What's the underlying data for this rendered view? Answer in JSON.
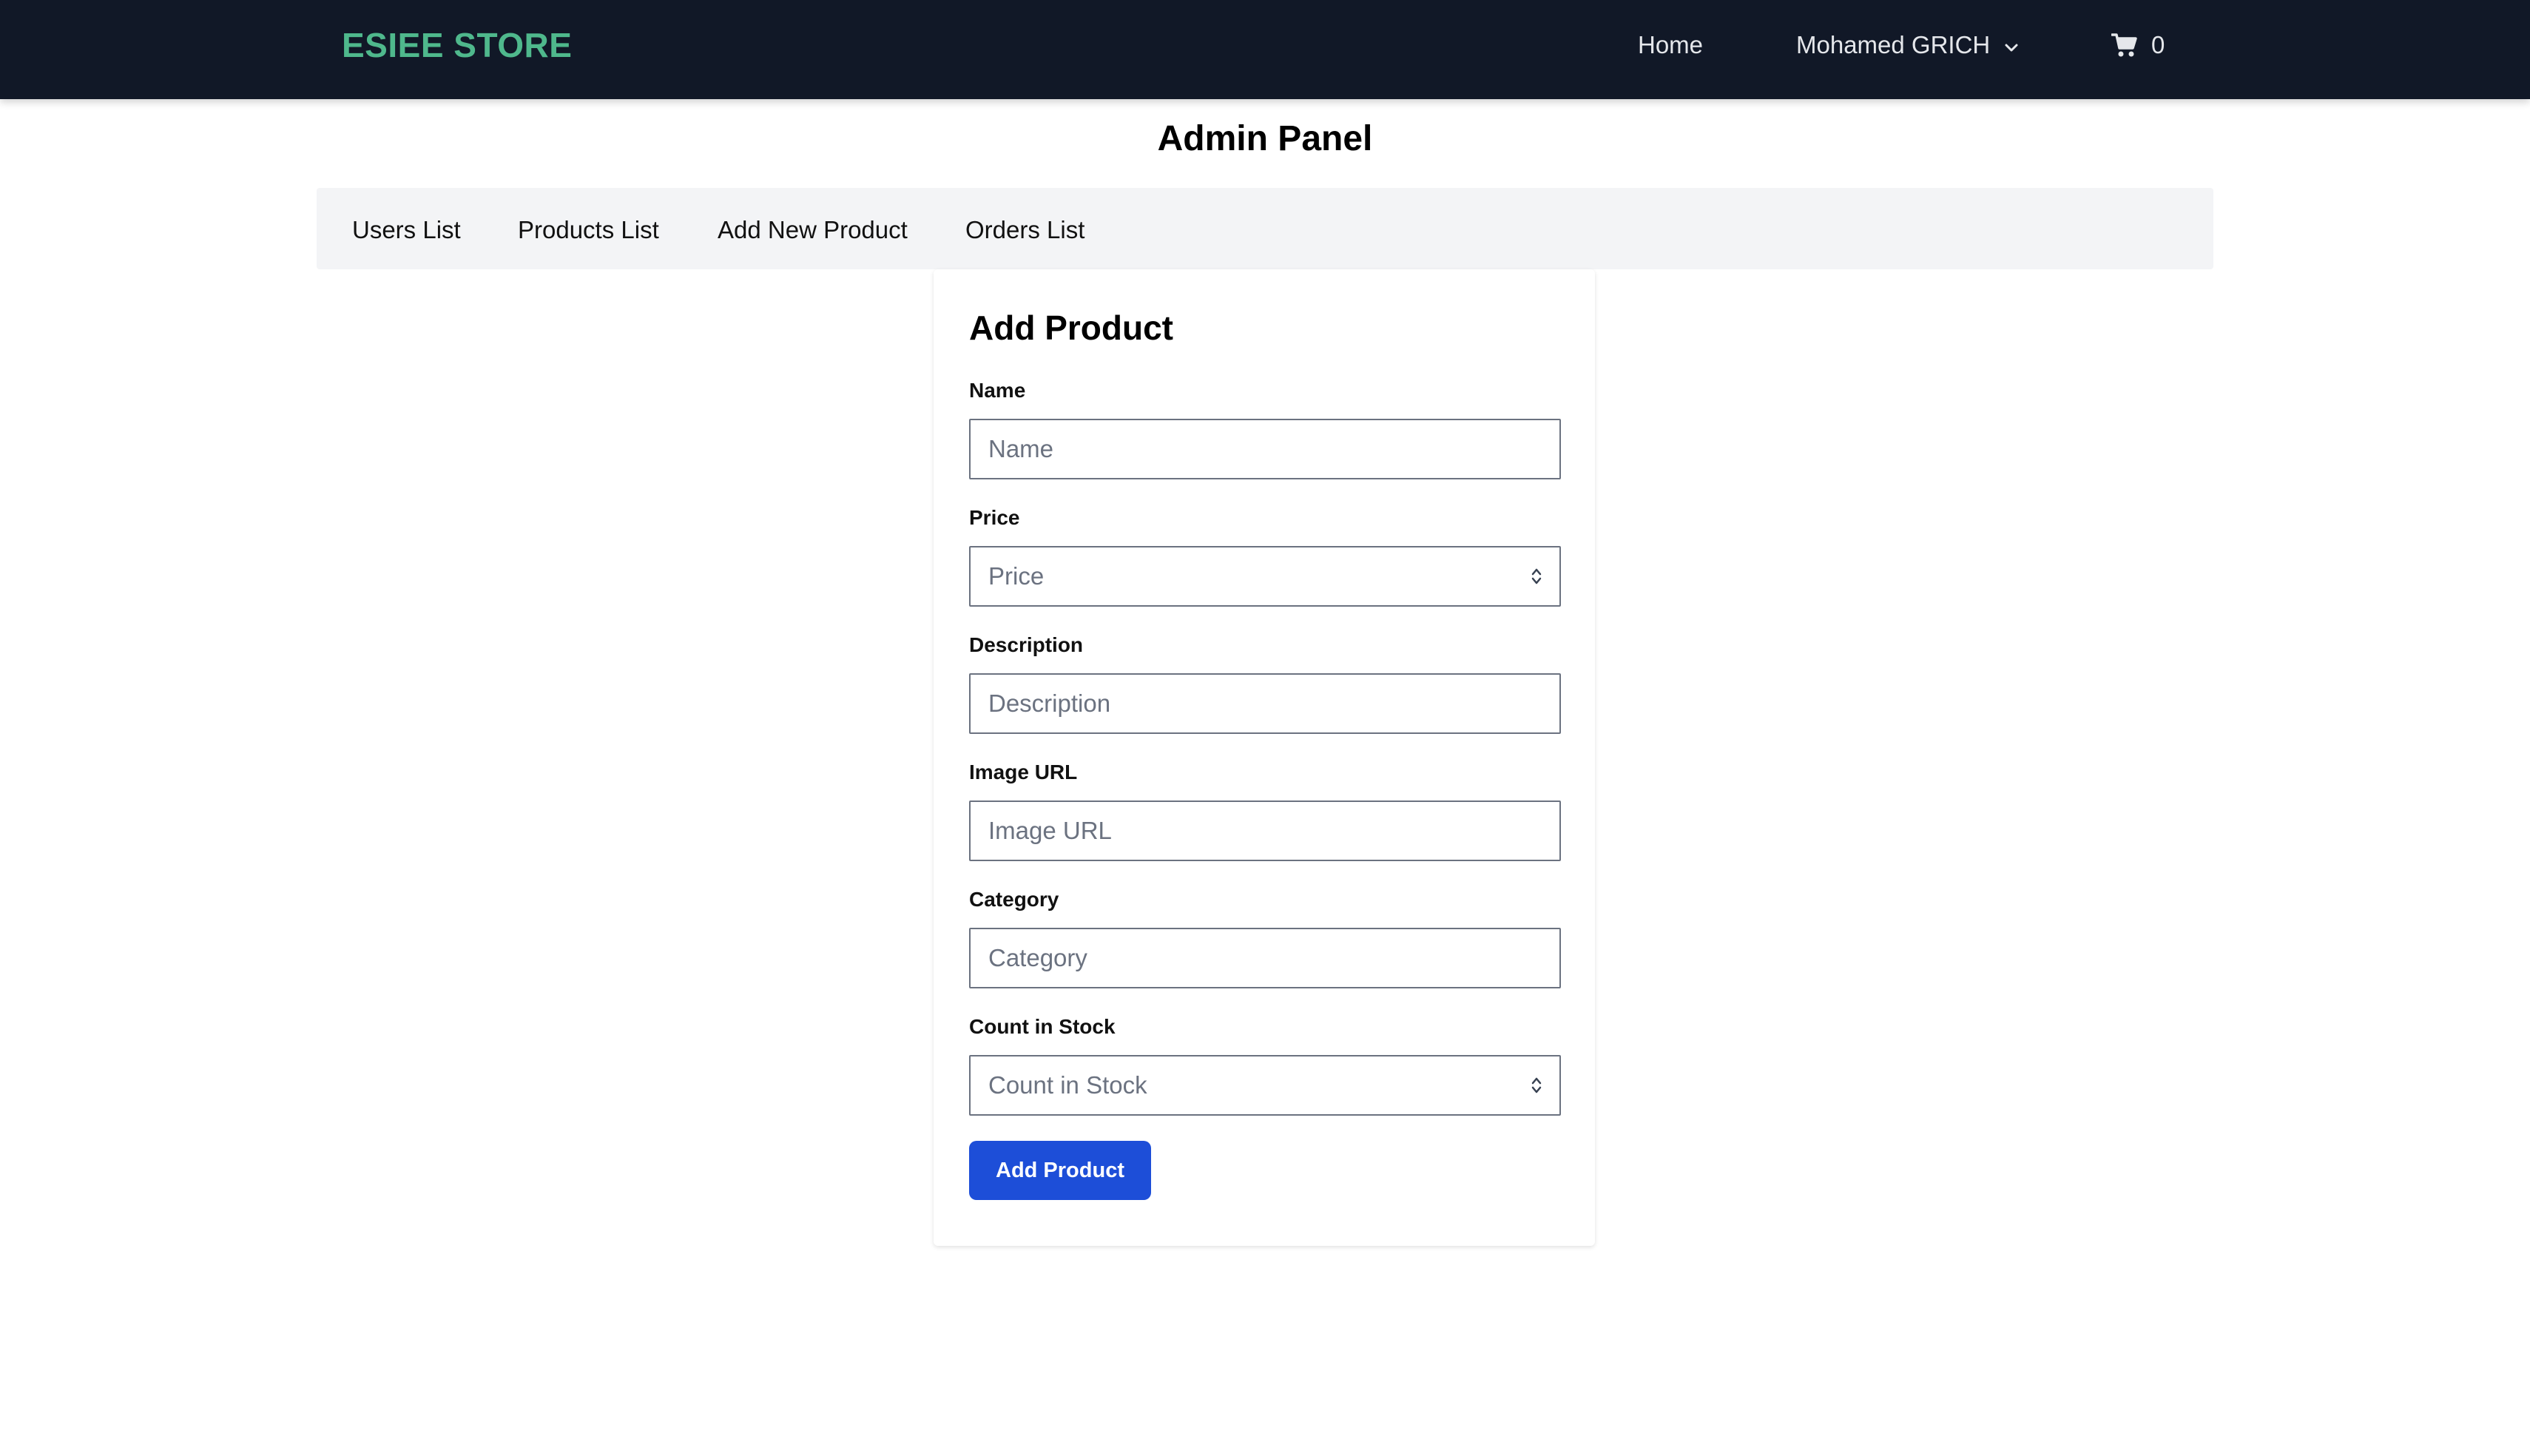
{
  "navbar": {
    "brand": "ESIEE STORE",
    "home": "Home",
    "user_name": "Mohamed GRICH",
    "cart_count": "0",
    "icons": {
      "user_menu": "chevron-down-icon",
      "cart": "shopping-cart-icon"
    }
  },
  "page": {
    "title": "Admin Panel"
  },
  "admin_nav": {
    "tabs": [
      {
        "label": "Users List"
      },
      {
        "label": "Products List"
      },
      {
        "label": "Add New Product"
      },
      {
        "label": "Orders List"
      }
    ]
  },
  "form": {
    "title": "Add Product",
    "fields": [
      {
        "label": "Name",
        "placeholder": "Name",
        "value": ""
      },
      {
        "label": "Price",
        "placeholder": "Price",
        "value": ""
      },
      {
        "label": "Description",
        "placeholder": "Description",
        "value": ""
      },
      {
        "label": "Image URL",
        "placeholder": "Image URL",
        "value": ""
      },
      {
        "label": "Category",
        "placeholder": "Category",
        "value": ""
      },
      {
        "label": "Count in Stock",
        "placeholder": "Count in Stock",
        "value": ""
      }
    ],
    "submit_label": "Add Product"
  },
  "colors": {
    "navbar_bg": "#111827",
    "brand": "#4fb88c",
    "primary_button": "#1d4ed8",
    "admin_nav_bg": "#f3f4f6"
  }
}
